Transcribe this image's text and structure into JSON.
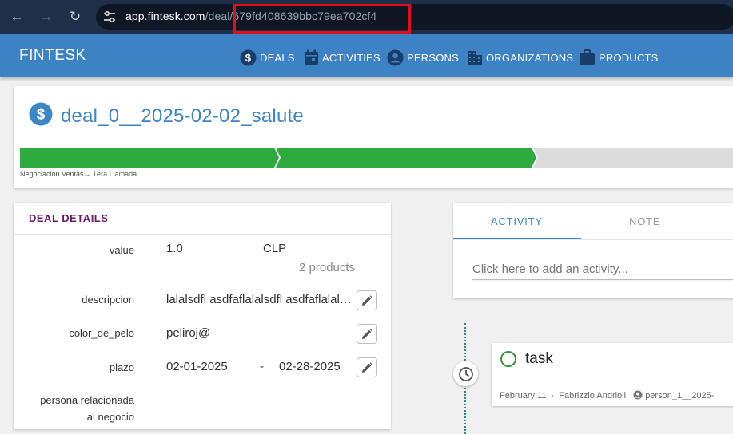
{
  "browser": {
    "url_host": "app.fintesk.com",
    "url_path_dim": "/deal",
    "url_id": "/679fd408639bbc79ea702cf4"
  },
  "app": {
    "brand": "FINTESK",
    "nav": [
      {
        "label": "DEALS",
        "icon": "dollar-circle-icon"
      },
      {
        "label": "ACTIVITIES",
        "icon": "calendar-icon"
      },
      {
        "label": "PERSONS",
        "icon": "person-circle-icon"
      },
      {
        "label": "ORGANIZATIONS",
        "icon": "building-icon"
      },
      {
        "label": "PRODUCTS",
        "icon": "briefcase-icon"
      }
    ]
  },
  "deal": {
    "title": "deal_0__2025-02-02_salute",
    "stage_caption": "Negociacion Ventas→ 1era Llamada",
    "pipeline_stages_completed": 2,
    "colors": {
      "stage_done": "#2eaa3f",
      "stage_todo": "#dcdcdc"
    }
  },
  "details": {
    "title": "DEAL DETAILS",
    "value_label": "value",
    "value": "1.0",
    "currency": "CLP",
    "products": "2 products",
    "descripcion_label": "descripcion",
    "descripcion": "lalalsdfl asdfaflalalsdfl asdfaflalalsdfl asdfafla",
    "color_label": "color_de_pelo",
    "color_value": "peliroj@",
    "plazo_label": "plazo",
    "plazo_start": "02-01-2025",
    "plazo_dash": "-",
    "plazo_end": "02-28-2025",
    "persona_label_1": "persona relacionada",
    "persona_label_2": "al negocio"
  },
  "activity": {
    "tab_activity": "ACTIVITY",
    "tab_note": "NOTE",
    "add_placeholder": "Click here to add an activity..."
  },
  "timeline": {
    "task_title": "task",
    "date": "February 11",
    "dot": "·",
    "owner": "Fabrizzio Andrioli",
    "person": "person_1__2025-"
  }
}
